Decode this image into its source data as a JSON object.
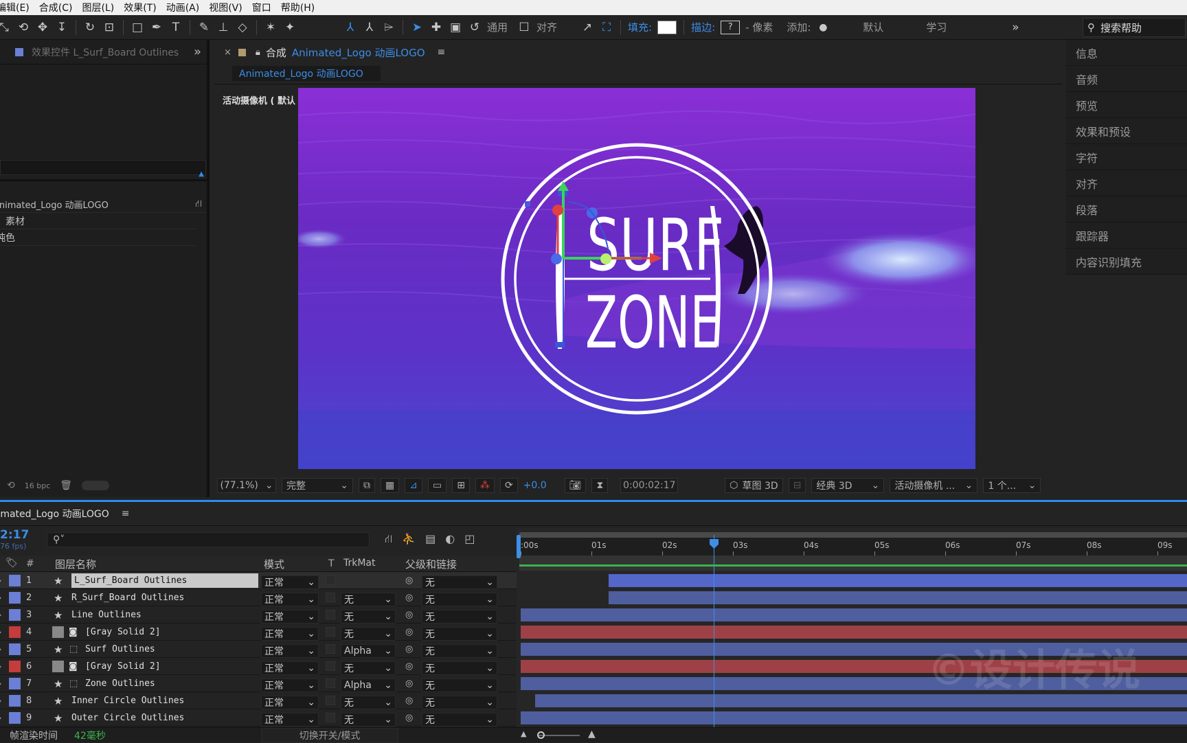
{
  "menubar": {
    "items": [
      "编辑(E)",
      "合成(C)",
      "图层(L)",
      "效果(T)",
      "动画(A)",
      "视图(V)",
      "窗口",
      "帮助(H)"
    ]
  },
  "toolbar": {
    "snap_label": "通用",
    "align_label": "对齐",
    "fill_label": "填充:",
    "stroke_label": "描边:",
    "stroke_value": "?",
    "pixels_label": "- 像素",
    "add_label": "添加:",
    "workspace_default": "默认",
    "workspace_learn": "学习",
    "search_label": "搜索帮助"
  },
  "left_panel": {
    "tab_title": "效果控件 L_Surf_Board Outlines",
    "project_items": [
      "Animated_Logo 动画LOGO",
      "素材",
      "纯色"
    ],
    "bpc": "16 bpc"
  },
  "comp_panel": {
    "tab_prefix": "合成",
    "tab_title": "Animated_Logo 动画LOGO",
    "breadcrumb": "Animated_Logo 动画LOGO",
    "camera_label": "活动摄像机 ( 默认 )",
    "logo_line1": "SURF",
    "logo_line2": "ZONE",
    "zoom": "(77.1%)",
    "resolution": "完整",
    "exposure": "+0.0",
    "timecode": "0:00:02:17",
    "draft3d": "草图 3D",
    "renderer": "经典 3D",
    "camera_select": "活动摄像机 ...",
    "views": "1 个..."
  },
  "right_panel": {
    "items": [
      "信息",
      "音频",
      "预览",
      "效果和预设",
      "字符",
      "对齐",
      "段落",
      "跟踪器",
      "内容识别填充"
    ]
  },
  "timeline": {
    "tab_title": "Animated_Logo 动画LOGO",
    "timecode": "2:17",
    "fps": "76 fps)",
    "columns": {
      "num": "#",
      "name": "图层名称",
      "mode": "模式",
      "t": "T",
      "trkmat": "TrkMat",
      "parent": "父级和链接"
    },
    "ruler": [
      ":00s",
      "01s",
      "02s",
      "03s",
      "04s",
      "05s",
      "06s",
      "07s",
      "08s",
      "09s"
    ],
    "layers": [
      {
        "num": "1",
        "name": "L_Surf_Board Outlines",
        "mode": "正常",
        "trkmat": "",
        "parent": "无",
        "color": "#6b7fd6",
        "type": "shape",
        "start": 0.131,
        "bar_color": "#5566c9"
      },
      {
        "num": "2",
        "name": "R_Surf_Board Outlines",
        "mode": "正常",
        "trkmat": "无",
        "parent": "无",
        "color": "#6b7fd6",
        "type": "shape",
        "start": 0.131,
        "bar_color": "#4f5e9e"
      },
      {
        "num": "3",
        "name": "Line Outlines",
        "mode": "正常",
        "trkmat": "无",
        "parent": "无",
        "color": "#6b7fd6",
        "type": "shape",
        "start": 0.0,
        "bar_color": "#4f5e9e"
      },
      {
        "num": "4",
        "name": "[Gray Solid 2]",
        "mode": "正常",
        "trkmat": "无",
        "parent": "无",
        "color": "#c43c3c",
        "type": "solid",
        "start": 0.0,
        "bar_color": "#9e4146"
      },
      {
        "num": "5",
        "name": "Surf Outlines",
        "mode": "正常",
        "trkmat": "Alpha",
        "parent": "无",
        "color": "#6b7fd6",
        "type": "shape",
        "start": 0.0,
        "bar_color": "#4f5e9e"
      },
      {
        "num": "6",
        "name": "[Gray Solid 2]",
        "mode": "正常",
        "trkmat": "无",
        "parent": "无",
        "color": "#c43c3c",
        "type": "solid",
        "start": 0.0,
        "bar_color": "#9e4146"
      },
      {
        "num": "7",
        "name": "Zone Outlines",
        "mode": "正常",
        "trkmat": "Alpha",
        "parent": "无",
        "color": "#6b7fd6",
        "type": "shape",
        "start": 0.0,
        "bar_color": "#4f5e9e"
      },
      {
        "num": "8",
        "name": "Inner Circle Outlines",
        "mode": "正常",
        "trkmat": "无",
        "parent": "无",
        "color": "#6b7fd6",
        "type": "shape",
        "start": 0.022,
        "bar_color": "#4f5e9e"
      },
      {
        "num": "9",
        "name": "Outer Circle Outlines",
        "mode": "正常",
        "trkmat": "无",
        "parent": "无",
        "color": "#6b7fd6",
        "type": "shape",
        "start": 0.0,
        "bar_color": "#4f5e9e"
      }
    ],
    "render_time_label": "帧渲染时间",
    "render_time_value": "42毫秒",
    "toggle_label": "切换开关/模式",
    "watermark": "©设计传说"
  },
  "colors": {
    "accent": "#2d8ceb",
    "playhead": "#3d8fe6",
    "work_area": "#39b54a"
  }
}
